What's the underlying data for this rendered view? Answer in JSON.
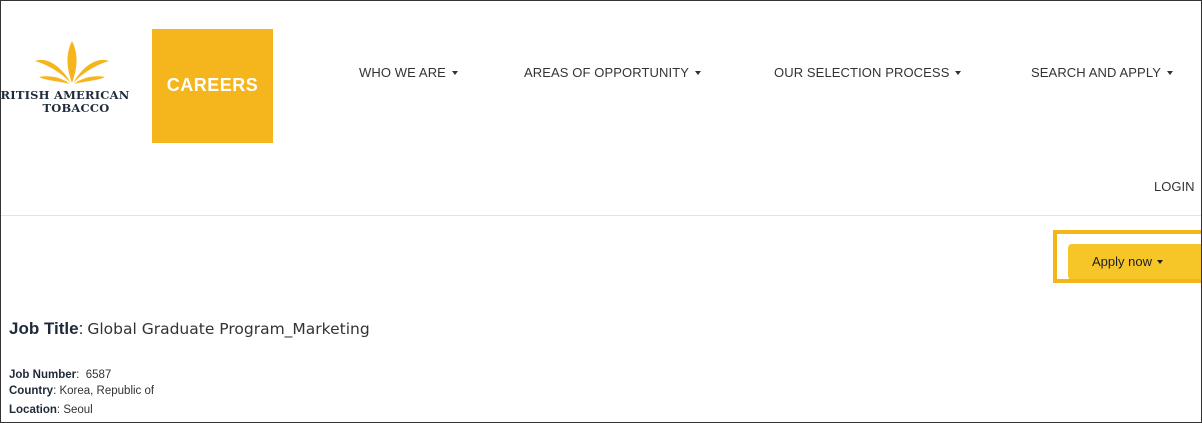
{
  "header": {
    "logo_text_line1": "RITISH AMERICAN",
    "logo_text_line2": "TOBACCO",
    "careers_label": "CAREERS",
    "brand_color": "#f5b51c"
  },
  "nav": {
    "items": [
      {
        "label": "WHO WE ARE"
      },
      {
        "label": "AREAS OF OPPORTUNITY"
      },
      {
        "label": "OUR SELECTION PROCESS"
      },
      {
        "label": "SEARCH AND APPLY"
      }
    ],
    "login_label": "LOGIN"
  },
  "actions": {
    "apply_label": "Apply now",
    "highlight_color": "#f2b51a"
  },
  "job": {
    "title_label": "Job Title",
    "title_value": "Global Graduate Program_Marketing",
    "number_label": "Job Number",
    "number_value": "6587",
    "country_label": "Country",
    "country_value": "Korea, Republic of",
    "location_label": "Location",
    "location_value": "Seoul"
  }
}
